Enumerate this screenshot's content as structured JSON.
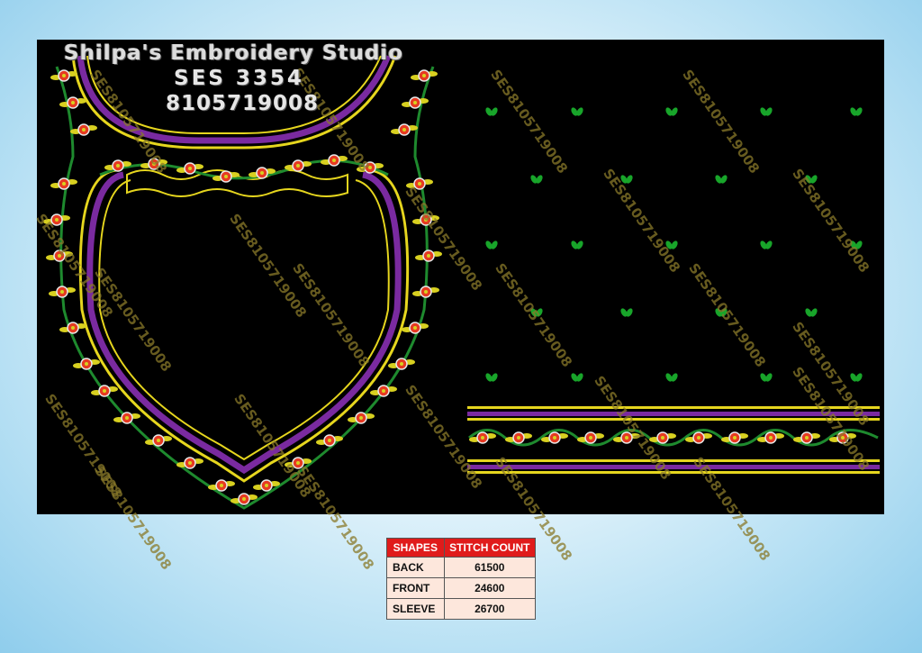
{
  "design": {
    "studio_name": "Shilpa's Embroidery Studio",
    "code": "SES 3354",
    "phone": "8105719008",
    "watermark": "SES8105719008"
  },
  "colors": {
    "background": "#000000",
    "vine": "#1e8a2e",
    "leaf": "#d8d020",
    "flower": "#e63a22",
    "bead": "#e8e8e8",
    "border_gold": "#e6d61e",
    "border_purple": "#7a2aa0",
    "motif": "#18a52a"
  },
  "stitch_table": {
    "header_shapes": "SHAPES",
    "header_count": "STITCH COUNT",
    "rows": [
      {
        "shape": "BACK",
        "count": "61500"
      },
      {
        "shape": "FRONT",
        "count": "24600"
      },
      {
        "shape": "SLEEVE",
        "count": "26700"
      }
    ]
  }
}
